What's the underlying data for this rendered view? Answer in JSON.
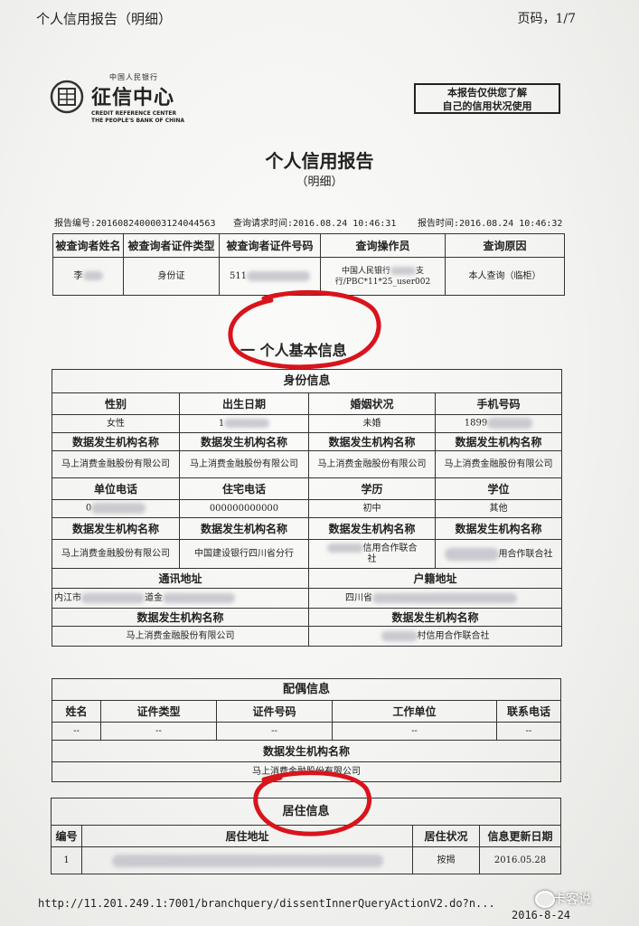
{
  "header": {
    "window_title": "个人信用报告（明细）",
    "page_num": "页码，1/7"
  },
  "logo": {
    "small_top": "中国人民银行",
    "main": "征信中心",
    "en1": "CREDIT REFERENCE CENTER",
    "en2": "THE PEOPLE'S BANK OF CHINA"
  },
  "stamp": {
    "line1": "本报告仅供您了解",
    "line2": "自己的信用状况使用"
  },
  "report": {
    "title": "个人信用报告",
    "subtitle": "（明细）",
    "number": "报告编号:2016082400003124044563",
    "query_time": "查询请求时间:2016.08.24 10:46:31",
    "report_time": "报告时间:2016.08.24 10:46:32"
  },
  "query": {
    "headers": [
      "被查询者姓名",
      "被查询者证件类型",
      "被查询者证件号码",
      "查询操作员",
      "查询原因"
    ],
    "name": "李",
    "id_type": "身份证",
    "id_no": "511",
    "operator_1": "中国人民银行",
    "operator_1b": "支",
    "operator_2": "行/PBC*11*25_user002",
    "reason": "本人查询（临柜）"
  },
  "section": {
    "title": "一 个人基本信息"
  },
  "identity": {
    "title": "身份信息",
    "r1_headers": [
      "性别",
      "出生日期",
      "婚姻状况",
      "手机号码"
    ],
    "gender": "女性",
    "birth": "1",
    "marital": "未婚",
    "mobile": "1899",
    "org_header": "数据发生机构名称",
    "r1_orgs": [
      "马上消费金融股份有限公司",
      "马上消费金融股份有限公司",
      "马上消费金融股份有限公司",
      "马上消费金融股份有限公司"
    ],
    "r2_headers": [
      "单位电话",
      "住宅电话",
      "学历",
      "学位"
    ],
    "work_phone": "0",
    "home_phone": "000000000000",
    "education": "初中",
    "degree": "其他",
    "r2_org_1": "马上消费金融股份有限公司",
    "r2_org_2": "中国建设银行四川省分行",
    "r2_org_3a": "信用合作联合",
    "r2_org_3b": "社",
    "r2_org_4": "用合作联合社",
    "addr_headers": [
      "通讯地址",
      "户籍地址"
    ],
    "mail_addr_a": "内江市",
    "mail_addr_b": "道金",
    "hukou_addr": "四川省",
    "addr_org_1": "马上消费金融股份有限公司",
    "addr_org_2": "村信用合作联合社"
  },
  "spouse": {
    "title": "配偶信息",
    "headers": [
      "姓名",
      "证件类型",
      "证件号码",
      "工作单位",
      "联系电话"
    ],
    "values": [
      "--",
      "--",
      "--",
      "--",
      "--"
    ],
    "org_header": "数据发生机构名称",
    "org": "马上消费金融股份有限公司"
  },
  "residence": {
    "title": "居住信息",
    "headers": [
      "编号",
      "居住地址",
      "居住状况",
      "信息更新日期"
    ],
    "row_no": "1",
    "row_status": "按揭",
    "row_date": "2016.05.28"
  },
  "footer": {
    "url": "http://11.201.249.1:7001/branchquery/dissentInnerQueryActionV2.do?n...",
    "date": "2016-8-24",
    "watermark": "卡客说"
  },
  "colors": {
    "annotation": "#d9141c",
    "paper": "#f7f7f6"
  }
}
